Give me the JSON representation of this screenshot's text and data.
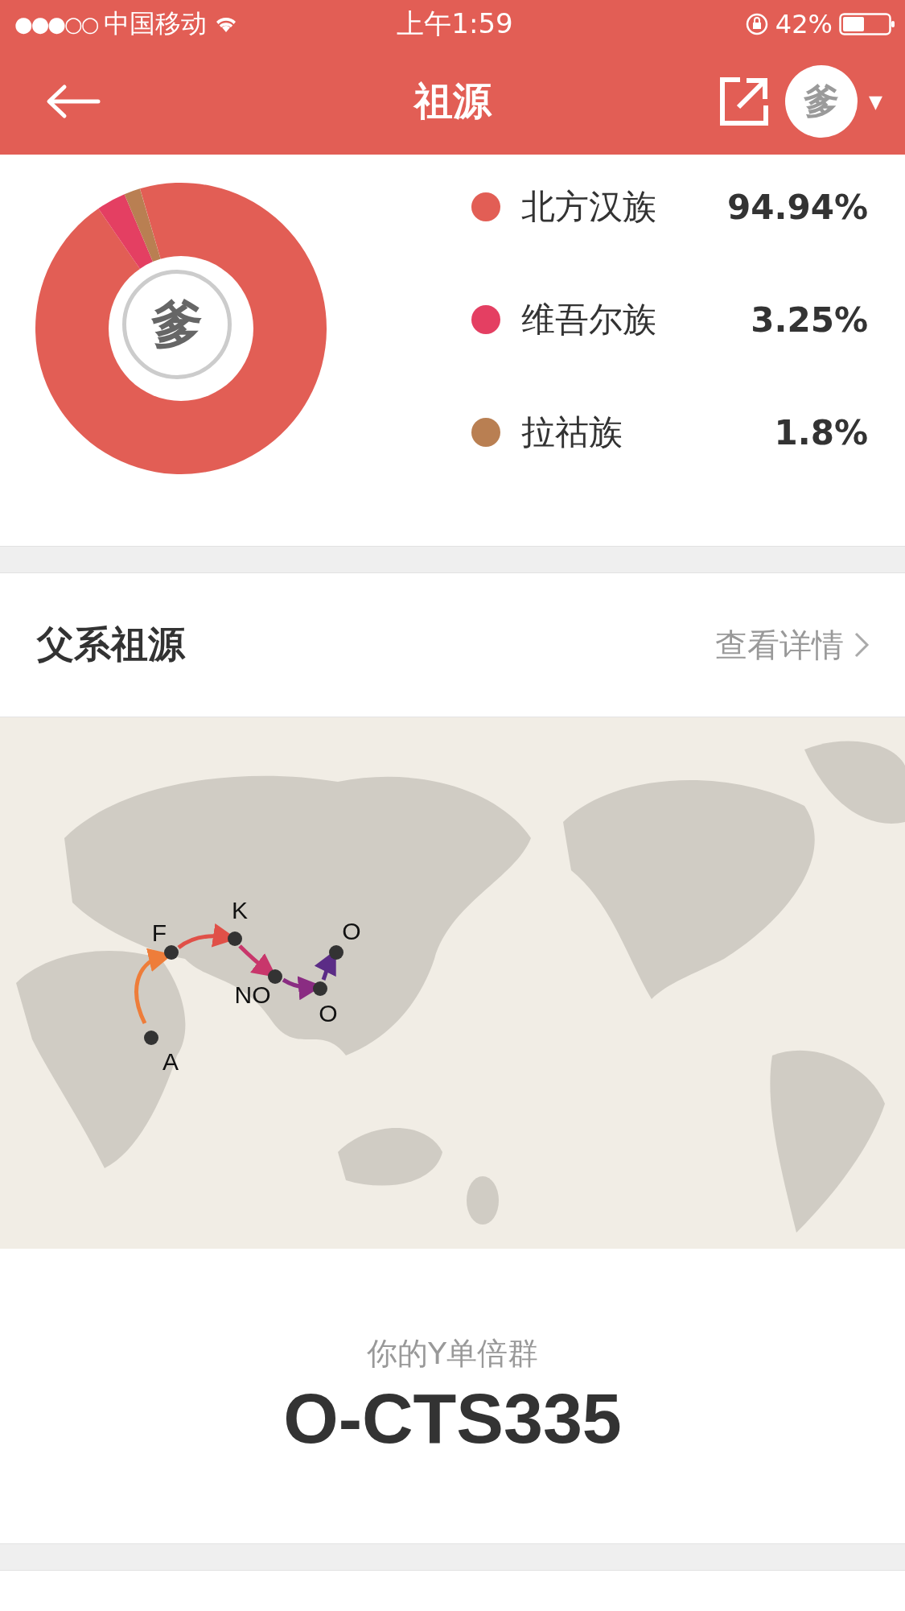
{
  "status_bar": {
    "signal": "●●●○○",
    "carrier": "中国移动",
    "time": "上午1:59",
    "battery": "42%"
  },
  "header": {
    "title": "祖源",
    "avatar": "爹",
    "caret": "▼"
  },
  "ancestry": {
    "center_label": "爹",
    "legend": [
      {
        "name": "北方汉族",
        "percent": "94.94%",
        "color": "#e25e55"
      },
      {
        "name": "维吾尔族",
        "percent": "3.25%",
        "color": "#e43f62"
      },
      {
        "name": "拉祜族",
        "percent": "1.8%",
        "color": "#b97f52"
      }
    ],
    "chart_data": {
      "type": "donut",
      "values": [
        94.94,
        3.25,
        1.8
      ]
    }
  },
  "paternal": {
    "title": "父系祖源",
    "link": "查看详情",
    "route": [
      {
        "label": "A"
      },
      {
        "label": "F"
      },
      {
        "label": "K"
      },
      {
        "label": "NO"
      },
      {
        "label": "O"
      },
      {
        "label": "O"
      }
    ]
  },
  "haplogroup": {
    "label": "你的Y单倍群",
    "value": "O-CTS335"
  }
}
